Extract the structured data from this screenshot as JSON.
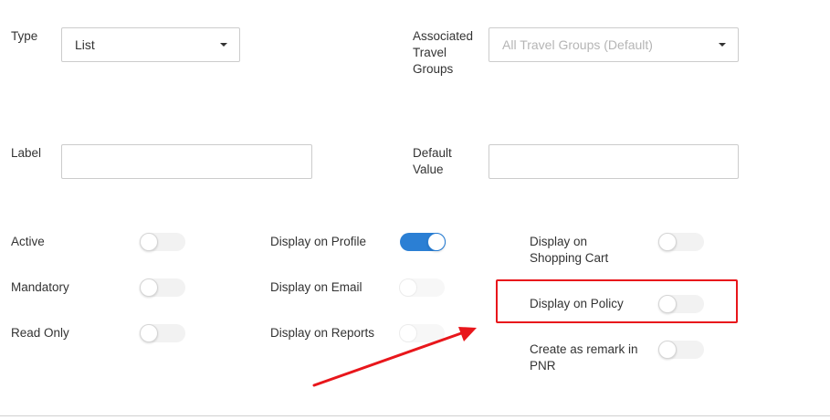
{
  "form": {
    "type_label": "Type",
    "type_value": "List",
    "groups_label": "Associated Travel Groups",
    "groups_placeholder": "All Travel Groups (Default)",
    "label_label": "Label",
    "label_value": "",
    "default_label": "Default Value",
    "default_value": ""
  },
  "toggles": {
    "active": {
      "label": "Active",
      "on": false
    },
    "mandatory": {
      "label": "Mandatory",
      "on": false
    },
    "read_only": {
      "label": "Read Only",
      "on": false
    },
    "display_profile": {
      "label": "Display on Profile",
      "on": true
    },
    "display_email": {
      "label": "Display on Email",
      "on": false
    },
    "display_reports": {
      "label": "Display on Reports",
      "on": false
    },
    "display_cart": {
      "label": "Display on Shopping Cart",
      "on": false
    },
    "display_policy": {
      "label": "Display on Policy",
      "on": false
    },
    "remark_pnr": {
      "label": "Create as remark in PNR",
      "on": false
    }
  },
  "colors": {
    "accent": "#2b7fd4",
    "annotation": "#e8161b"
  },
  "icons": {
    "dropdown": "caret-down-icon",
    "annotation_arrow": "red-arrow"
  }
}
